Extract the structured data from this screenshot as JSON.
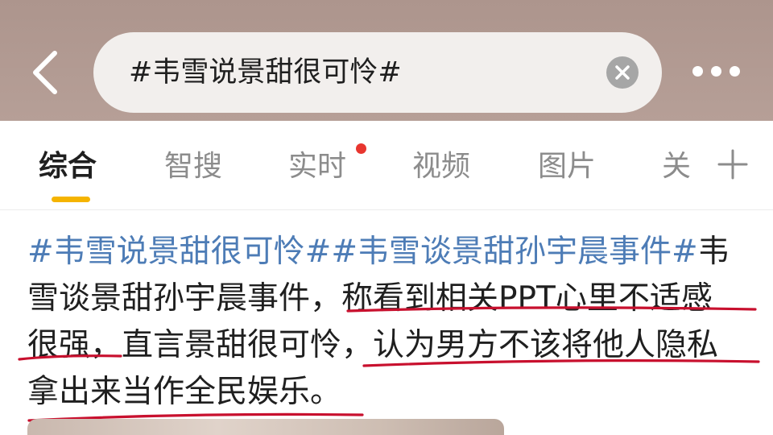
{
  "search": {
    "query": "#韦雪说景甜很可怜#"
  },
  "tabs": [
    {
      "label": "综合",
      "active": true
    },
    {
      "label": "智搜",
      "active": false
    },
    {
      "label": "实时",
      "active": false,
      "has_dot": true
    },
    {
      "label": "视频",
      "active": false
    },
    {
      "label": "图片",
      "active": false
    },
    {
      "label": "关",
      "active": false
    }
  ],
  "post": {
    "tag1": "#韦雪说景甜很可怜#",
    "tag2": "#韦雪谈景甜孙宇晨事件#",
    "line1_tail": "韦",
    "line2": "雪谈景甜孙宇晨事件，称看到相关PPT心里不适感",
    "line3": "很强，直言景甜很可怜，认为男方不该将他人隐私",
    "line4": "拿出来当作全民娱乐。"
  },
  "icons": {
    "back": "back-arrow-icon",
    "clear": "clear-icon",
    "more": "more-icon",
    "plus": "plus-icon"
  },
  "colors": {
    "header_bg": "#ad958d",
    "tag": "#4d7cb6",
    "active_underline": "#f5b400",
    "notification_dot": "#e8362f",
    "annotation_ink": "#c8102e"
  }
}
